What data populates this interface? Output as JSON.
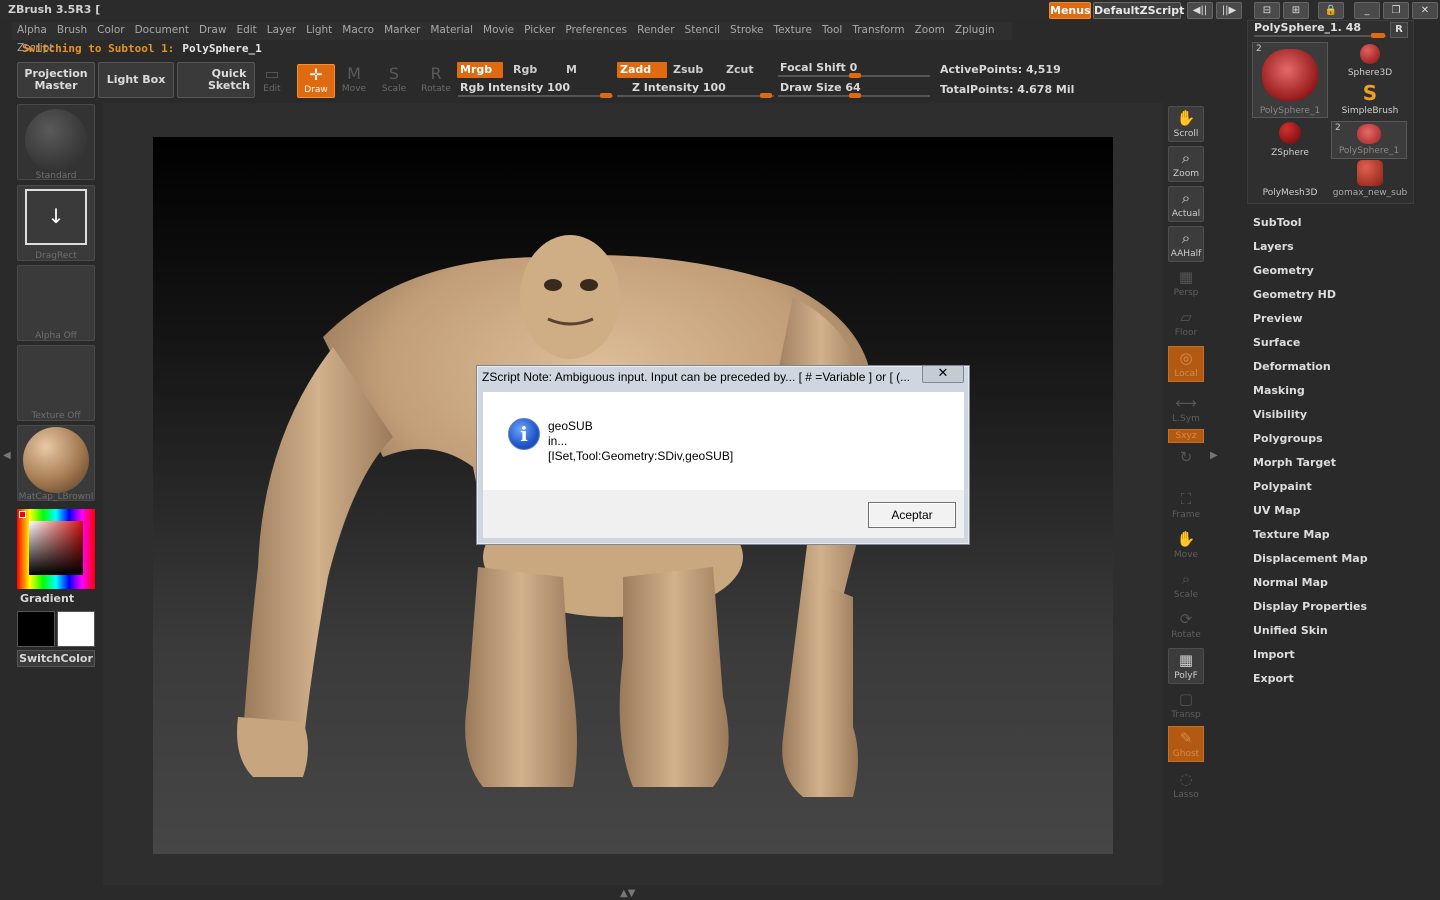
{
  "window": {
    "title": "ZBrush 3.5R3  [",
    "menus_button": "Menus",
    "script_button": "DefaultZScript"
  },
  "menubar": [
    "Alpha",
    "Brush",
    "Color",
    "Document",
    "Draw",
    "Edit",
    "Layer",
    "Light",
    "Macro",
    "Marker",
    "Material",
    "Movie",
    "Picker",
    "Preferences",
    "Render",
    "Stencil",
    "Stroke",
    "Texture",
    "Tool",
    "Transform",
    "Zoom",
    "Zplugin",
    "Zscript"
  ],
  "status": {
    "label": "Switching to Subtool 1:",
    "value": "PolySphere_1"
  },
  "toolbar": {
    "projection_master": "Projection Master",
    "light_box": "Light Box",
    "quick_sketch": "Quick Sketch",
    "edit": "Edit",
    "draw": "Draw",
    "move": "Move",
    "scale": "Scale",
    "rotate": "Rotate",
    "mrgb": "Mrgb",
    "rgb": "Rgb",
    "m": "M",
    "rgb_intensity": "Rgb Intensity 100",
    "zadd": "Zadd",
    "zsub": "Zsub",
    "zcut": "Zcut",
    "z_intensity": "Z Intensity 100",
    "focal_shift": "Focal Shift 0",
    "draw_size": "Draw Size 64",
    "active_points": "ActivePoints: 4,519",
    "total_points": "TotalPoints: 4.678 Mil"
  },
  "left_palette": {
    "brush": "Standard",
    "stroke": "DragRect",
    "alpha": "Alpha  Off",
    "texture": "Texture  Off",
    "material": "MatCap_LBrownI",
    "gradient": "Gradient",
    "switch_color": "SwitchColor"
  },
  "right_shelf": {
    "scroll": "Scroll",
    "zoom": "Zoom",
    "actual": "Actual",
    "aahalf": "AAHalf",
    "persp": "Persp",
    "floor": "Floor",
    "local": "Local",
    "lsym": "L.Sym",
    "xyz": "Sxyz",
    "frame": "Frame",
    "move": "Move",
    "scale": "Scale",
    "rotate": "Rotate",
    "polyf": "PolyF",
    "transp": "Transp",
    "ghost": "Ghost",
    "lasso": "Lasso"
  },
  "tool_panel": {
    "header": "PolySphere_1. 48",
    "r_button": "R",
    "items": [
      {
        "label": "PolySphere_1",
        "badge": "2"
      },
      {
        "label": "Sphere3D",
        "badge": ""
      },
      {
        "label": "SimpleBrush",
        "badge": ""
      },
      {
        "label": "ZSphere",
        "badge": ""
      },
      {
        "label": "PolySphere_1",
        "badge": "2"
      },
      {
        "label": "PolyMesh3D",
        "badge": ""
      },
      {
        "label": "gomax_new_sub",
        "badge": ""
      }
    ]
  },
  "tool_palette": [
    "SubTool",
    "Layers",
    "Geometry",
    "Geometry HD",
    "Preview",
    "Surface",
    "Deformation",
    "Masking",
    "Visibility",
    "Polygroups",
    "Morph Target",
    "Polypaint",
    "UV Map",
    "Texture Map",
    "Displacement Map",
    "Normal Map",
    "Display Properties",
    "Unified Skin",
    "Import",
    "Export"
  ],
  "dialog": {
    "title": "ZScript Note: Ambiguous input. Input can be preceded by... [ # =Variable ] or [ (...",
    "close": "✕",
    "line1": "geoSUB",
    "line2": "in...",
    "line3": "[ISet,Tool:Geometry:SDiv,geoSUB]",
    "ok": "Aceptar"
  },
  "colors": {
    "accent": "#e06a10",
    "model_skin": "#c8a47e",
    "background": "#2a2a2a"
  }
}
